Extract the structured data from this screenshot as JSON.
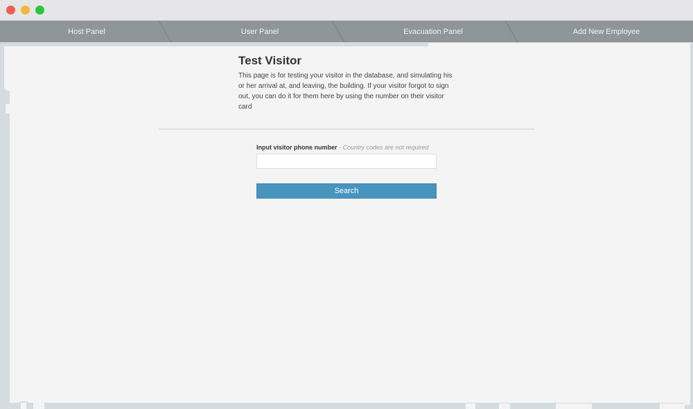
{
  "nav": {
    "items": [
      {
        "label": "Host Panel"
      },
      {
        "label": "User Panel"
      },
      {
        "label": "Evacuation Panel"
      },
      {
        "label": "Add New Employee"
      }
    ]
  },
  "main": {
    "title": "Test Visitor",
    "description": "This page is for testing your visitor in the database, and simulating his or her arrival at, and leaving, the building. If your visitor forgot to sign out, you can do it for them here by using the number on their visitor card"
  },
  "form": {
    "label": "Input visitor phone number",
    "hint": " - Country codes are not required",
    "input_value": "",
    "input_placeholder": "",
    "search_label": "Search"
  },
  "colors": {
    "accent": "#4795bf",
    "navbar": "#8e969a"
  }
}
